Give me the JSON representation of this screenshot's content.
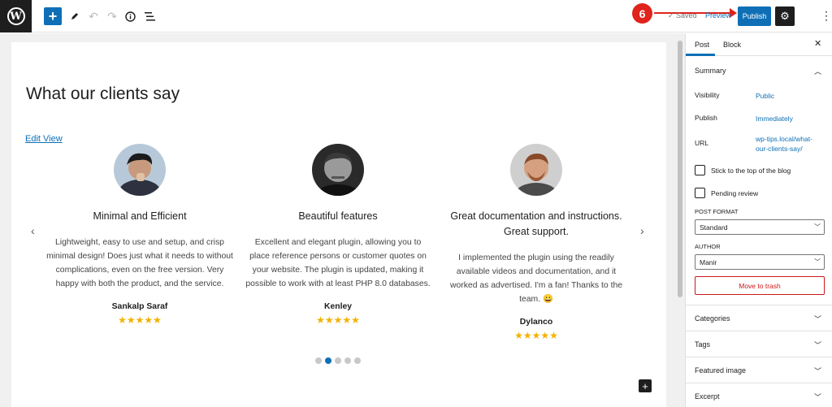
{
  "topbar": {
    "logo_letter": "W",
    "add_icon": "plus-icon",
    "edit_icon": "pencil-icon",
    "undo_icon": "undo-icon",
    "redo_icon": "redo-icon",
    "info_icon": "info-icon",
    "outline_icon": "list-view-icon",
    "saved_label": "Saved",
    "preview_label": "Preview",
    "publish_label": "Publish",
    "settings_icon": "gear-icon",
    "more_icon": "kebab-menu-icon",
    "step_badge": "6",
    "accent_color": "#0f6fb6",
    "annotation_color": "#e0231c"
  },
  "editor": {
    "page_title": "What our clients say",
    "edit_view_link": "Edit View",
    "prev_arrow": "‹",
    "next_arrow": "›",
    "slides": [
      {
        "title": "Minimal and Efficient",
        "text": "Lightweight, easy to use and setup, and crisp minimal design! Does just what it needs to without complications, even on the free version. Very happy with both the product, and the service.",
        "author": "Sankalp Saraf",
        "stars": "★★★★★"
      },
      {
        "title": "Beautiful features",
        "text": "Excellent and elegant plugin, allowing you to place reference persons or customer quotes on your website. The plugin is updated, making it possible to work with at least PHP 8.0 databases.",
        "author": "Kenley",
        "stars": "★★★★★"
      },
      {
        "title": "Great documentation and instructions. Great support.",
        "text": "I implemented the plugin using the readily available videos and documentation, and it worked as advertised. I'm a fan! Thanks to the team. 😀",
        "author": "Dylanco",
        "stars": "★★★★★"
      }
    ],
    "active_dot": 1,
    "dot_count": 5,
    "star_color": "#f3b200"
  },
  "sidebar": {
    "tabs": [
      "Post",
      "Block"
    ],
    "close_icon": "close-icon",
    "summary_heading": "Summary",
    "visibility_label": "Visibility",
    "visibility_value": "Public",
    "publish_label": "Publish",
    "publish_value": "Immediately",
    "url_label": "URL",
    "url_value": "wp-tips.local/what-our-clients-say/",
    "stick_label": "Stick to the top of the blog",
    "pending_label": "Pending review",
    "post_format_label": "POST FORMAT",
    "post_format_value": "Standard",
    "author_label": "AUTHOR",
    "author_value": "Manir",
    "trash_label": "Move to trash",
    "panels": [
      "Categories",
      "Tags",
      "Featured image",
      "Excerpt"
    ]
  }
}
